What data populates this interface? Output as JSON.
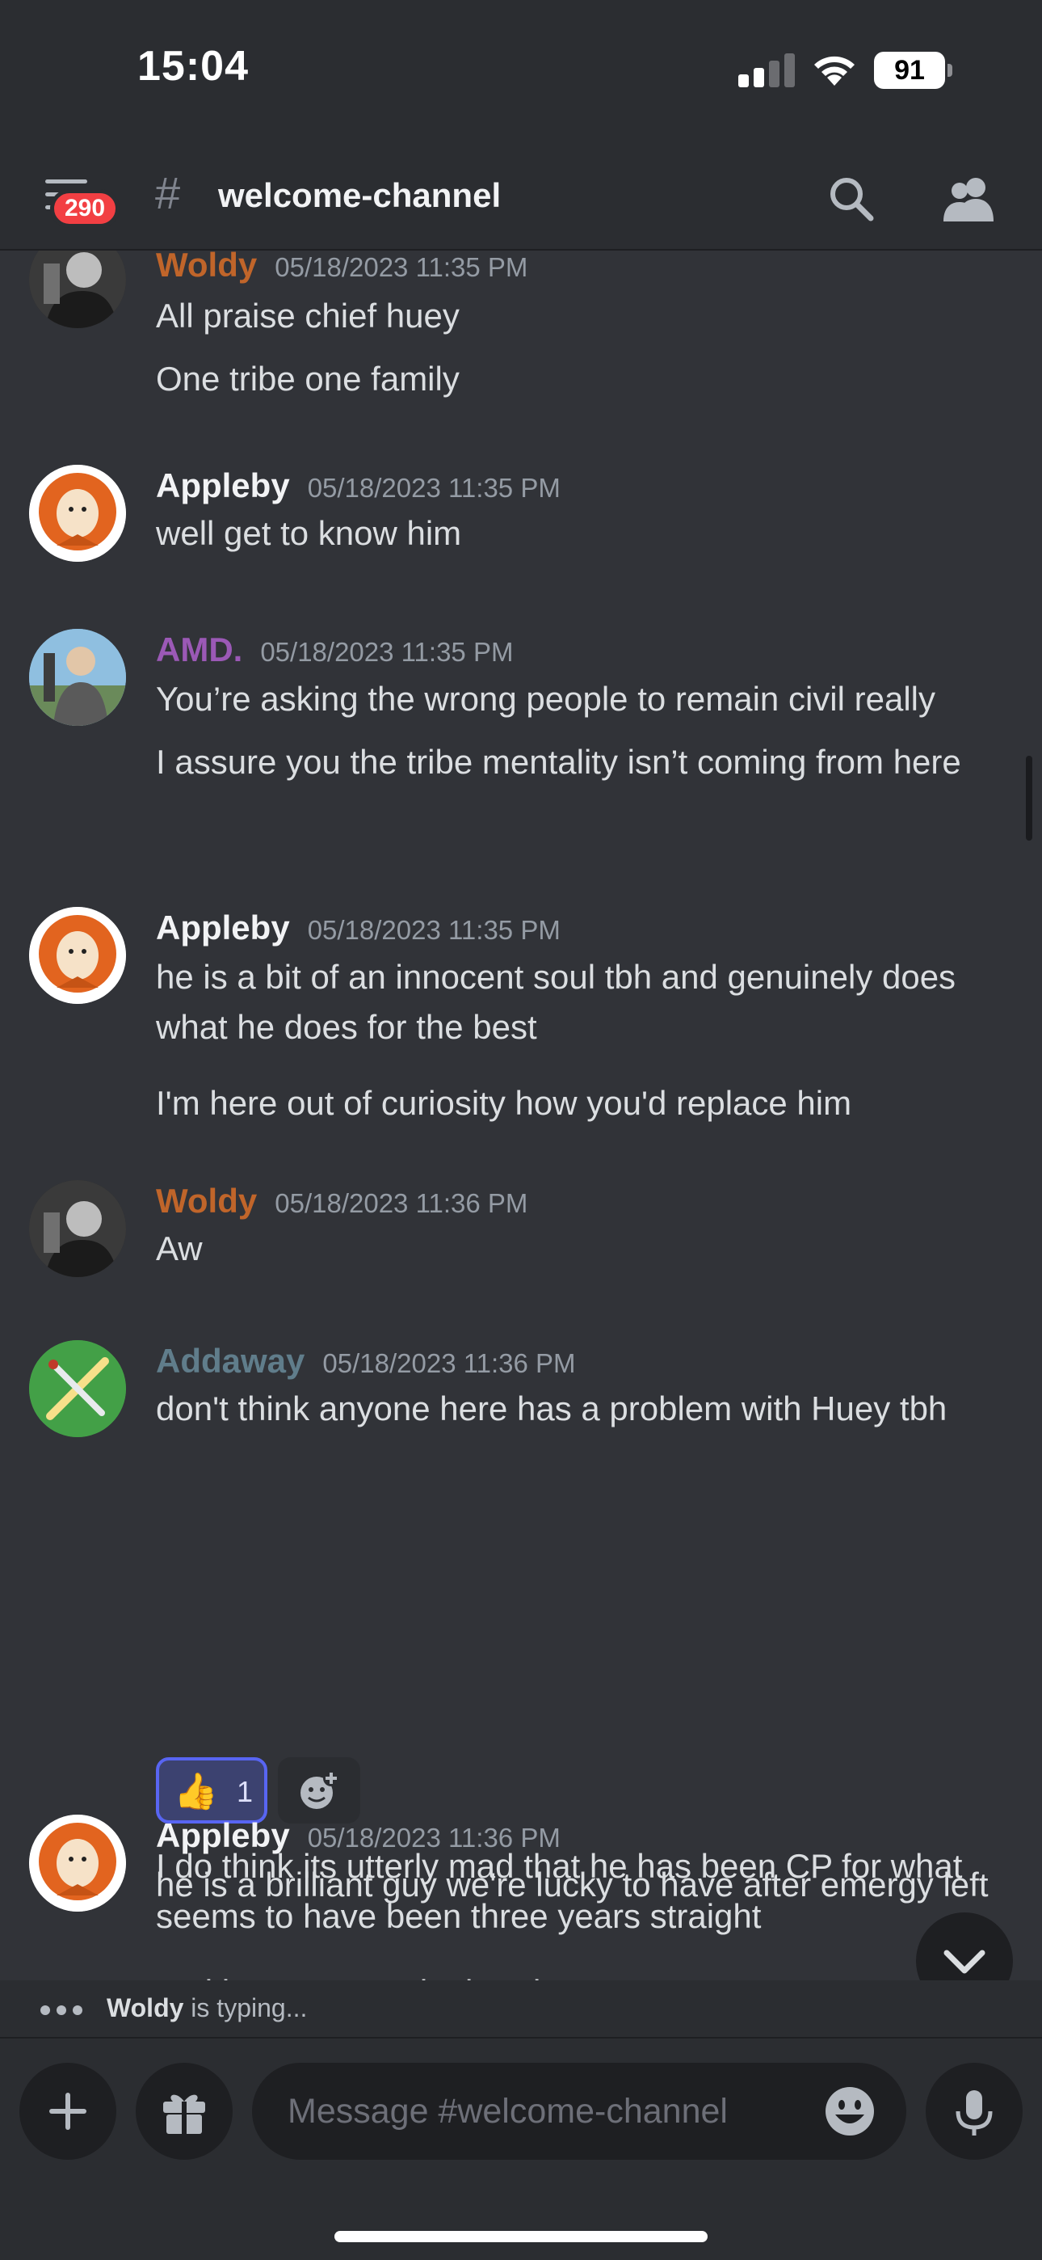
{
  "status_bar": {
    "time": "15:04",
    "battery": "91"
  },
  "header": {
    "unread_badge": "290",
    "channel_name": "welcome-channel"
  },
  "messages": [
    {
      "author": "Woldy",
      "author_color": "#c0652a",
      "timestamp": "05/18/2023 11:35 PM",
      "lines": [
        "All praise chief huey",
        "One tribe one family"
      ]
    },
    {
      "author": "Appleby",
      "author_color": "#f2f3f5",
      "timestamp": "05/18/2023 11:35 PM",
      "lines": [
        "well get to know him"
      ]
    },
    {
      "author": "AMD.",
      "author_color": "#9b59b6",
      "timestamp": "05/18/2023 11:35 PM",
      "lines": [
        "You’re asking the wrong people to remain civil really",
        "I assure you the tribe mentality isn’t coming from here"
      ]
    },
    {
      "author": "Appleby",
      "author_color": "#f2f3f5",
      "timestamp": "05/18/2023 11:35 PM",
      "lines": [
        "he is a bit of an innocent soul tbh and genuinely does what he does for the best",
        "I'm here out of curiosity how you'd replace him"
      ]
    },
    {
      "author": "Woldy",
      "author_color": "#c0652a",
      "timestamp": "05/18/2023 11:36 PM",
      "lines": [
        "Aw"
      ]
    },
    {
      "author": "Addaway",
      "author_color": "#607d8b",
      "timestamp": "05/18/2023 11:36 PM",
      "lines": [
        "don't think anyone here has a problem with Huey tbh",
        "I do think its utterly mad that he has been CP for what seems to have been three years straight",
        "and he must need a break"
      ],
      "reaction": {
        "emoji": "👍",
        "count": "1"
      }
    },
    {
      "author": "Appleby",
      "author_color": "#f2f3f5",
      "timestamp": "05/18/2023 11:36 PM",
      "lines": [
        "he is a brilliant guy we're lucky to have after emergy left"
      ]
    }
  ],
  "typing": {
    "user": "Woldy",
    "suffix": " is typing..."
  },
  "composer": {
    "placeholder": "Message #welcome-channel"
  },
  "colors": {
    "background": "#313338",
    "chrome": "#2b2d31",
    "input": "#1e1f22",
    "accent": "#5865f2",
    "badge": "#f23f43"
  }
}
